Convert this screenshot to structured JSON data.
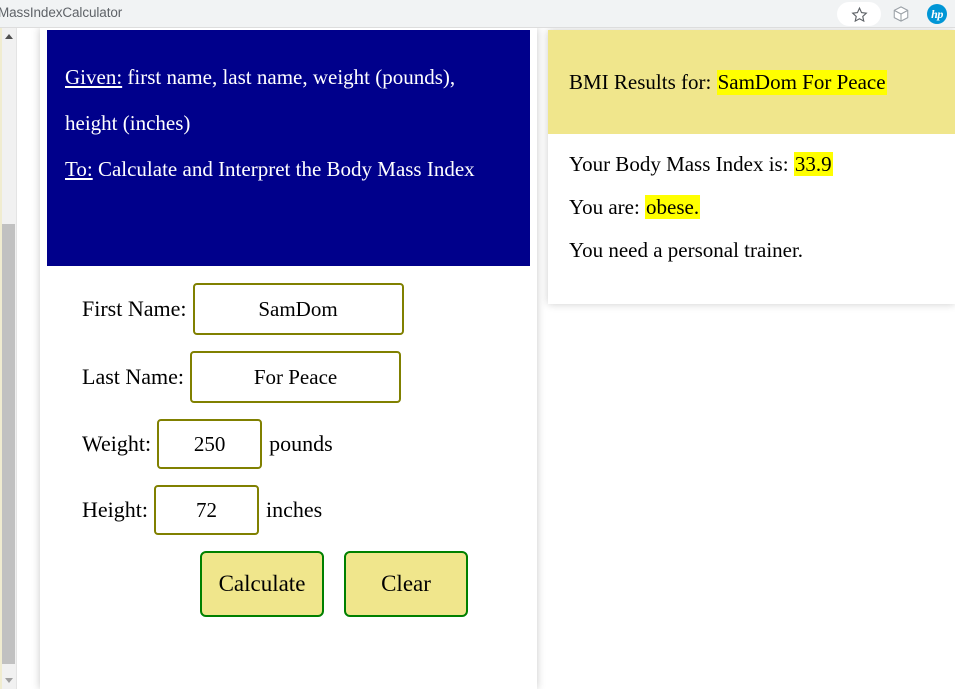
{
  "browser": {
    "tab_title": "MassIndexCalculator",
    "icons": {
      "bookmark": "star-icon",
      "extensions": "cube-icon",
      "profile": "hp-logo-icon",
      "profile_text": "hp"
    }
  },
  "scrollbar": {
    "up_arrow": "scroll-up-arrow",
    "down_arrow": "scroll-down-arrow",
    "thumb": "scroll-thumb"
  },
  "intro": {
    "given_label": "Given:",
    "given_text": " first name, last name, weight (pounds), height (inches)",
    "to_label": "To:",
    "to_text": " Calculate and Interpret the Body Mass Index"
  },
  "form": {
    "first_name_label": "First Name:",
    "first_name_value": "SamDom",
    "last_name_label": "Last Name:",
    "last_name_value": "For Peace",
    "weight_label": "Weight:",
    "weight_value": "250",
    "weight_unit": "pounds",
    "height_label": "Height:",
    "height_value": "72",
    "height_unit": "inches",
    "calculate_label": "Calculate",
    "clear_label": "Clear"
  },
  "results": {
    "header_prefix": "BMI Results for:",
    "header_name": "SamDom For Peace",
    "bmi_label": "Your Body Mass Index is:",
    "bmi_value": "33.9",
    "status_label": "You are:",
    "status_value": "obese.",
    "advice": "You need a personal trainer."
  },
  "colors": {
    "intro_panel": "#00008b",
    "khaki": "#f0e68c",
    "highlight": "#ffff00",
    "input_border": "#808000",
    "button_border": "#008000",
    "hp_blue": "#0096d6"
  }
}
